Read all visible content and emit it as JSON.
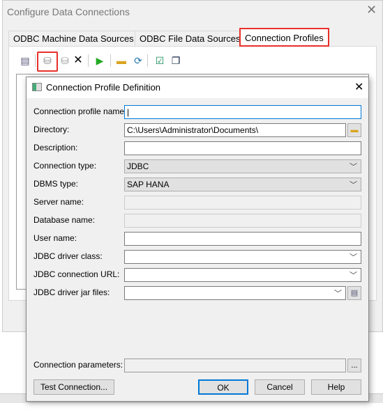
{
  "window": {
    "title": "Configure Data Connections",
    "close": "✕"
  },
  "tabs": [
    {
      "label": "ODBC Machine Data Sources"
    },
    {
      "label": "ODBC File Data Sources"
    },
    {
      "label": "Connection Profiles",
      "active": true
    }
  ],
  "toolbar": {
    "icons": [
      "properties-icon",
      "new-profile-icon",
      "add-icon",
      "delete-icon",
      "test-icon",
      "open-folder-icon",
      "refresh-icon",
      "check-all-icon",
      "uncheck-all-icon"
    ],
    "highlight_color": "#e8302a"
  },
  "dialog": {
    "title": "Connection Profile Definition",
    "close": "✕",
    "fields": [
      {
        "label": "Connection profile name:",
        "value": "|"
      },
      {
        "label": "Directory:",
        "value": "C:\\Users\\Administrator\\Documents\\"
      },
      {
        "label": "Description:",
        "value": ""
      },
      {
        "label": "Connection type:",
        "value": "JDBC"
      },
      {
        "label": "DBMS type:",
        "value": "SAP HANA"
      },
      {
        "label": "Server name:",
        "value": ""
      },
      {
        "label": "Database name:",
        "value": ""
      },
      {
        "label": "User name:",
        "value": ""
      },
      {
        "label": "JDBC driver class:",
        "value": ""
      },
      {
        "label": "JDBC connection URL:",
        "value": ""
      },
      {
        "label": "JDBC driver jar files:",
        "value": ""
      },
      {
        "label": "Connection parameters:",
        "value": ""
      }
    ],
    "ellipsis": "...",
    "buttons": {
      "test": "Test Connection...",
      "ok": "OK",
      "cancel": "Cancel",
      "help": "Help"
    }
  }
}
